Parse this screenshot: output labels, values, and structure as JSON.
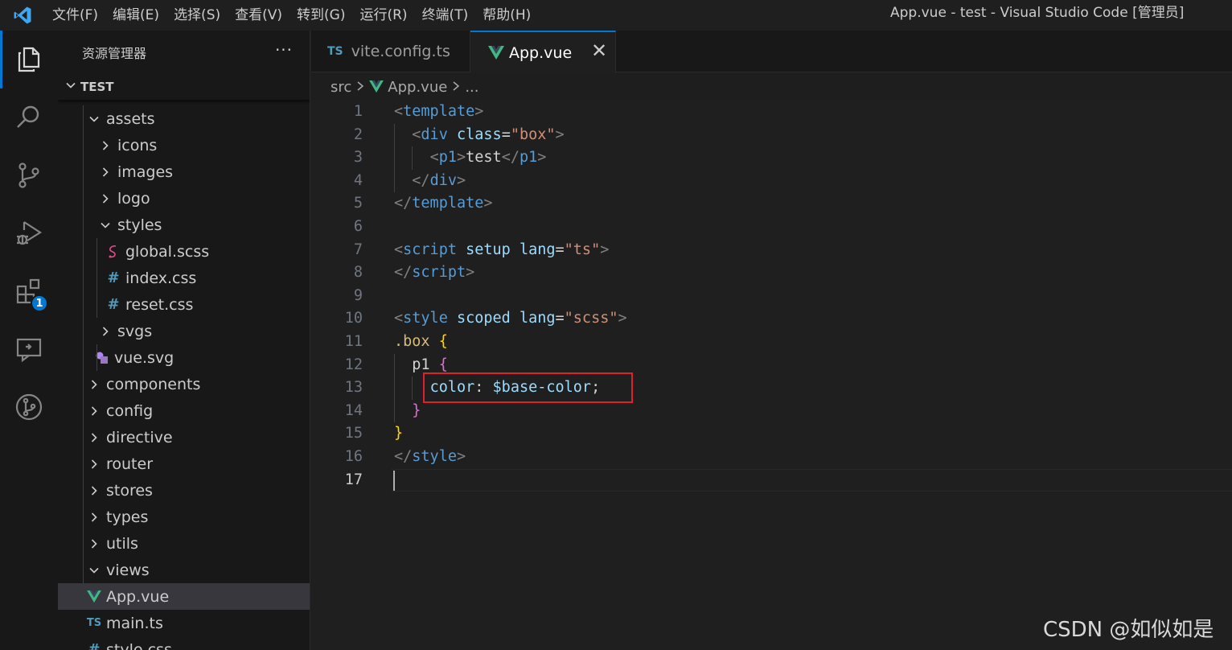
{
  "menu": [
    "文件(F)",
    "编辑(E)",
    "选择(S)",
    "查看(V)",
    "转到(G)",
    "运行(R)",
    "终端(T)",
    "帮助(H)"
  ],
  "window_title": "App.vue - test - Visual Studio Code [管理员]",
  "activity_bar": {
    "items": [
      "explorer-icon",
      "search-icon",
      "source-control-icon",
      "run-debug-icon",
      "extensions-icon",
      "remote-explorer-icon",
      "git-graph-icon"
    ],
    "extensions_badge": "1"
  },
  "sidebar": {
    "title": "资源管理器",
    "more": "···",
    "folder": "TEST",
    "tree": [
      {
        "label": "assets",
        "type": "folder",
        "open": true,
        "depth": 0
      },
      {
        "label": "icons",
        "type": "folder",
        "open": false,
        "depth": 1
      },
      {
        "label": "images",
        "type": "folder",
        "open": false,
        "depth": 1
      },
      {
        "label": "logo",
        "type": "folder",
        "open": false,
        "depth": 1
      },
      {
        "label": "styles",
        "type": "folder",
        "open": true,
        "depth": 1
      },
      {
        "label": "global.scss",
        "type": "scss",
        "depth": 2
      },
      {
        "label": "index.css",
        "type": "css",
        "depth": 2
      },
      {
        "label": "reset.css",
        "type": "css",
        "depth": 2
      },
      {
        "label": "svgs",
        "type": "folder",
        "open": false,
        "depth": 1
      },
      {
        "label": "vue.svg",
        "type": "svg",
        "depth": 1
      },
      {
        "label": "components",
        "type": "folder",
        "open": false,
        "depth": 0
      },
      {
        "label": "config",
        "type": "folder",
        "open": false,
        "depth": 0
      },
      {
        "label": "directive",
        "type": "folder",
        "open": false,
        "depth": 0
      },
      {
        "label": "router",
        "type": "folder",
        "open": false,
        "depth": 0
      },
      {
        "label": "stores",
        "type": "folder",
        "open": false,
        "depth": 0
      },
      {
        "label": "types",
        "type": "folder",
        "open": false,
        "depth": 0
      },
      {
        "label": "utils",
        "type": "folder",
        "open": false,
        "depth": 0
      },
      {
        "label": "views",
        "type": "folder",
        "open": true,
        "depth": 0
      },
      {
        "label": "App.vue",
        "type": "vue",
        "depth": -1,
        "selected": true
      },
      {
        "label": "main.ts",
        "type": "ts",
        "depth": -1
      },
      {
        "label": "style.css",
        "type": "css",
        "depth": -1
      }
    ]
  },
  "tabs": [
    {
      "label": "vite.config.ts",
      "badge": "TS",
      "active": false
    },
    {
      "label": "App.vue",
      "active": true,
      "close": "✕"
    }
  ],
  "breadcrumb": [
    "src",
    "App.vue",
    "..."
  ],
  "editor": {
    "current_line": 17,
    "lines": [
      {
        "n": "1",
        "tokens": [
          [
            "t-punct",
            "<"
          ],
          [
            "t-tag",
            "template"
          ],
          [
            "t-punct",
            ">"
          ]
        ]
      },
      {
        "n": "2",
        "tokens": [
          [
            "t-text",
            "  "
          ],
          [
            "t-punct",
            "<"
          ],
          [
            "t-tag",
            "div"
          ],
          [
            "t-text",
            " "
          ],
          [
            "t-attr",
            "class"
          ],
          [
            "t-text",
            "="
          ],
          [
            "t-str",
            "\"box\""
          ],
          [
            "t-punct",
            ">"
          ]
        ]
      },
      {
        "n": "3",
        "tokens": [
          [
            "t-text",
            "    "
          ],
          [
            "t-punct",
            "<"
          ],
          [
            "t-tag",
            "p1"
          ],
          [
            "t-punct",
            ">"
          ],
          [
            "t-text",
            "test"
          ],
          [
            "t-punct",
            "</"
          ],
          [
            "t-tag",
            "p1"
          ],
          [
            "t-punct",
            ">"
          ]
        ]
      },
      {
        "n": "4",
        "tokens": [
          [
            "t-text",
            "  "
          ],
          [
            "t-punct",
            "</"
          ],
          [
            "t-tag",
            "div"
          ],
          [
            "t-punct",
            ">"
          ]
        ]
      },
      {
        "n": "5",
        "tokens": [
          [
            "t-punct",
            "</"
          ],
          [
            "t-tag",
            "template"
          ],
          [
            "t-punct",
            ">"
          ]
        ]
      },
      {
        "n": "6",
        "tokens": []
      },
      {
        "n": "7",
        "tokens": [
          [
            "t-punct",
            "<"
          ],
          [
            "t-tag",
            "script"
          ],
          [
            "t-text",
            " "
          ],
          [
            "t-attr",
            "setup"
          ],
          [
            "t-text",
            " "
          ],
          [
            "t-attr",
            "lang"
          ],
          [
            "t-text",
            "="
          ],
          [
            "t-str",
            "\"ts\""
          ],
          [
            "t-punct",
            ">"
          ]
        ]
      },
      {
        "n": "8",
        "tokens": [
          [
            "t-punct",
            "</"
          ],
          [
            "t-tag",
            "script"
          ],
          [
            "t-punct",
            ">"
          ]
        ]
      },
      {
        "n": "9",
        "tokens": []
      },
      {
        "n": "10",
        "tokens": [
          [
            "t-punct",
            "<"
          ],
          [
            "t-tag",
            "style"
          ],
          [
            "t-text",
            " "
          ],
          [
            "t-attr",
            "scoped"
          ],
          [
            "t-text",
            " "
          ],
          [
            "t-attr",
            "lang"
          ],
          [
            "t-text",
            "="
          ],
          [
            "t-str",
            "\"scss\""
          ],
          [
            "t-punct",
            ">"
          ]
        ]
      },
      {
        "n": "11",
        "tokens": [
          [
            "t-sel",
            ".box"
          ],
          [
            "t-text",
            " "
          ],
          [
            "t-brace1",
            "{"
          ]
        ]
      },
      {
        "n": "12",
        "tokens": [
          [
            "t-text",
            "  p1 "
          ],
          [
            "t-brace2",
            "{"
          ]
        ]
      },
      {
        "n": "13",
        "tokens": [
          [
            "t-text",
            "    "
          ],
          [
            "t-prop",
            "color"
          ],
          [
            "t-text",
            ": "
          ],
          [
            "t-var",
            "$base-color"
          ],
          [
            "t-text",
            ";"
          ]
        ]
      },
      {
        "n": "14",
        "tokens": [
          [
            "t-text",
            "  "
          ],
          [
            "t-brace2",
            "}"
          ]
        ]
      },
      {
        "n": "15",
        "tokens": [
          [
            "t-brace1",
            "}"
          ]
        ]
      },
      {
        "n": "16",
        "tokens": [
          [
            "t-punct",
            "</"
          ],
          [
            "t-tag",
            "style"
          ],
          [
            "t-punct",
            ">"
          ]
        ]
      },
      {
        "n": "17",
        "tokens": []
      }
    ]
  },
  "watermark": "CSDN @如似如是",
  "colors": {
    "accent": "#0078d4",
    "highlight_box": "#e0202a",
    "vue_green": "#41b883"
  }
}
